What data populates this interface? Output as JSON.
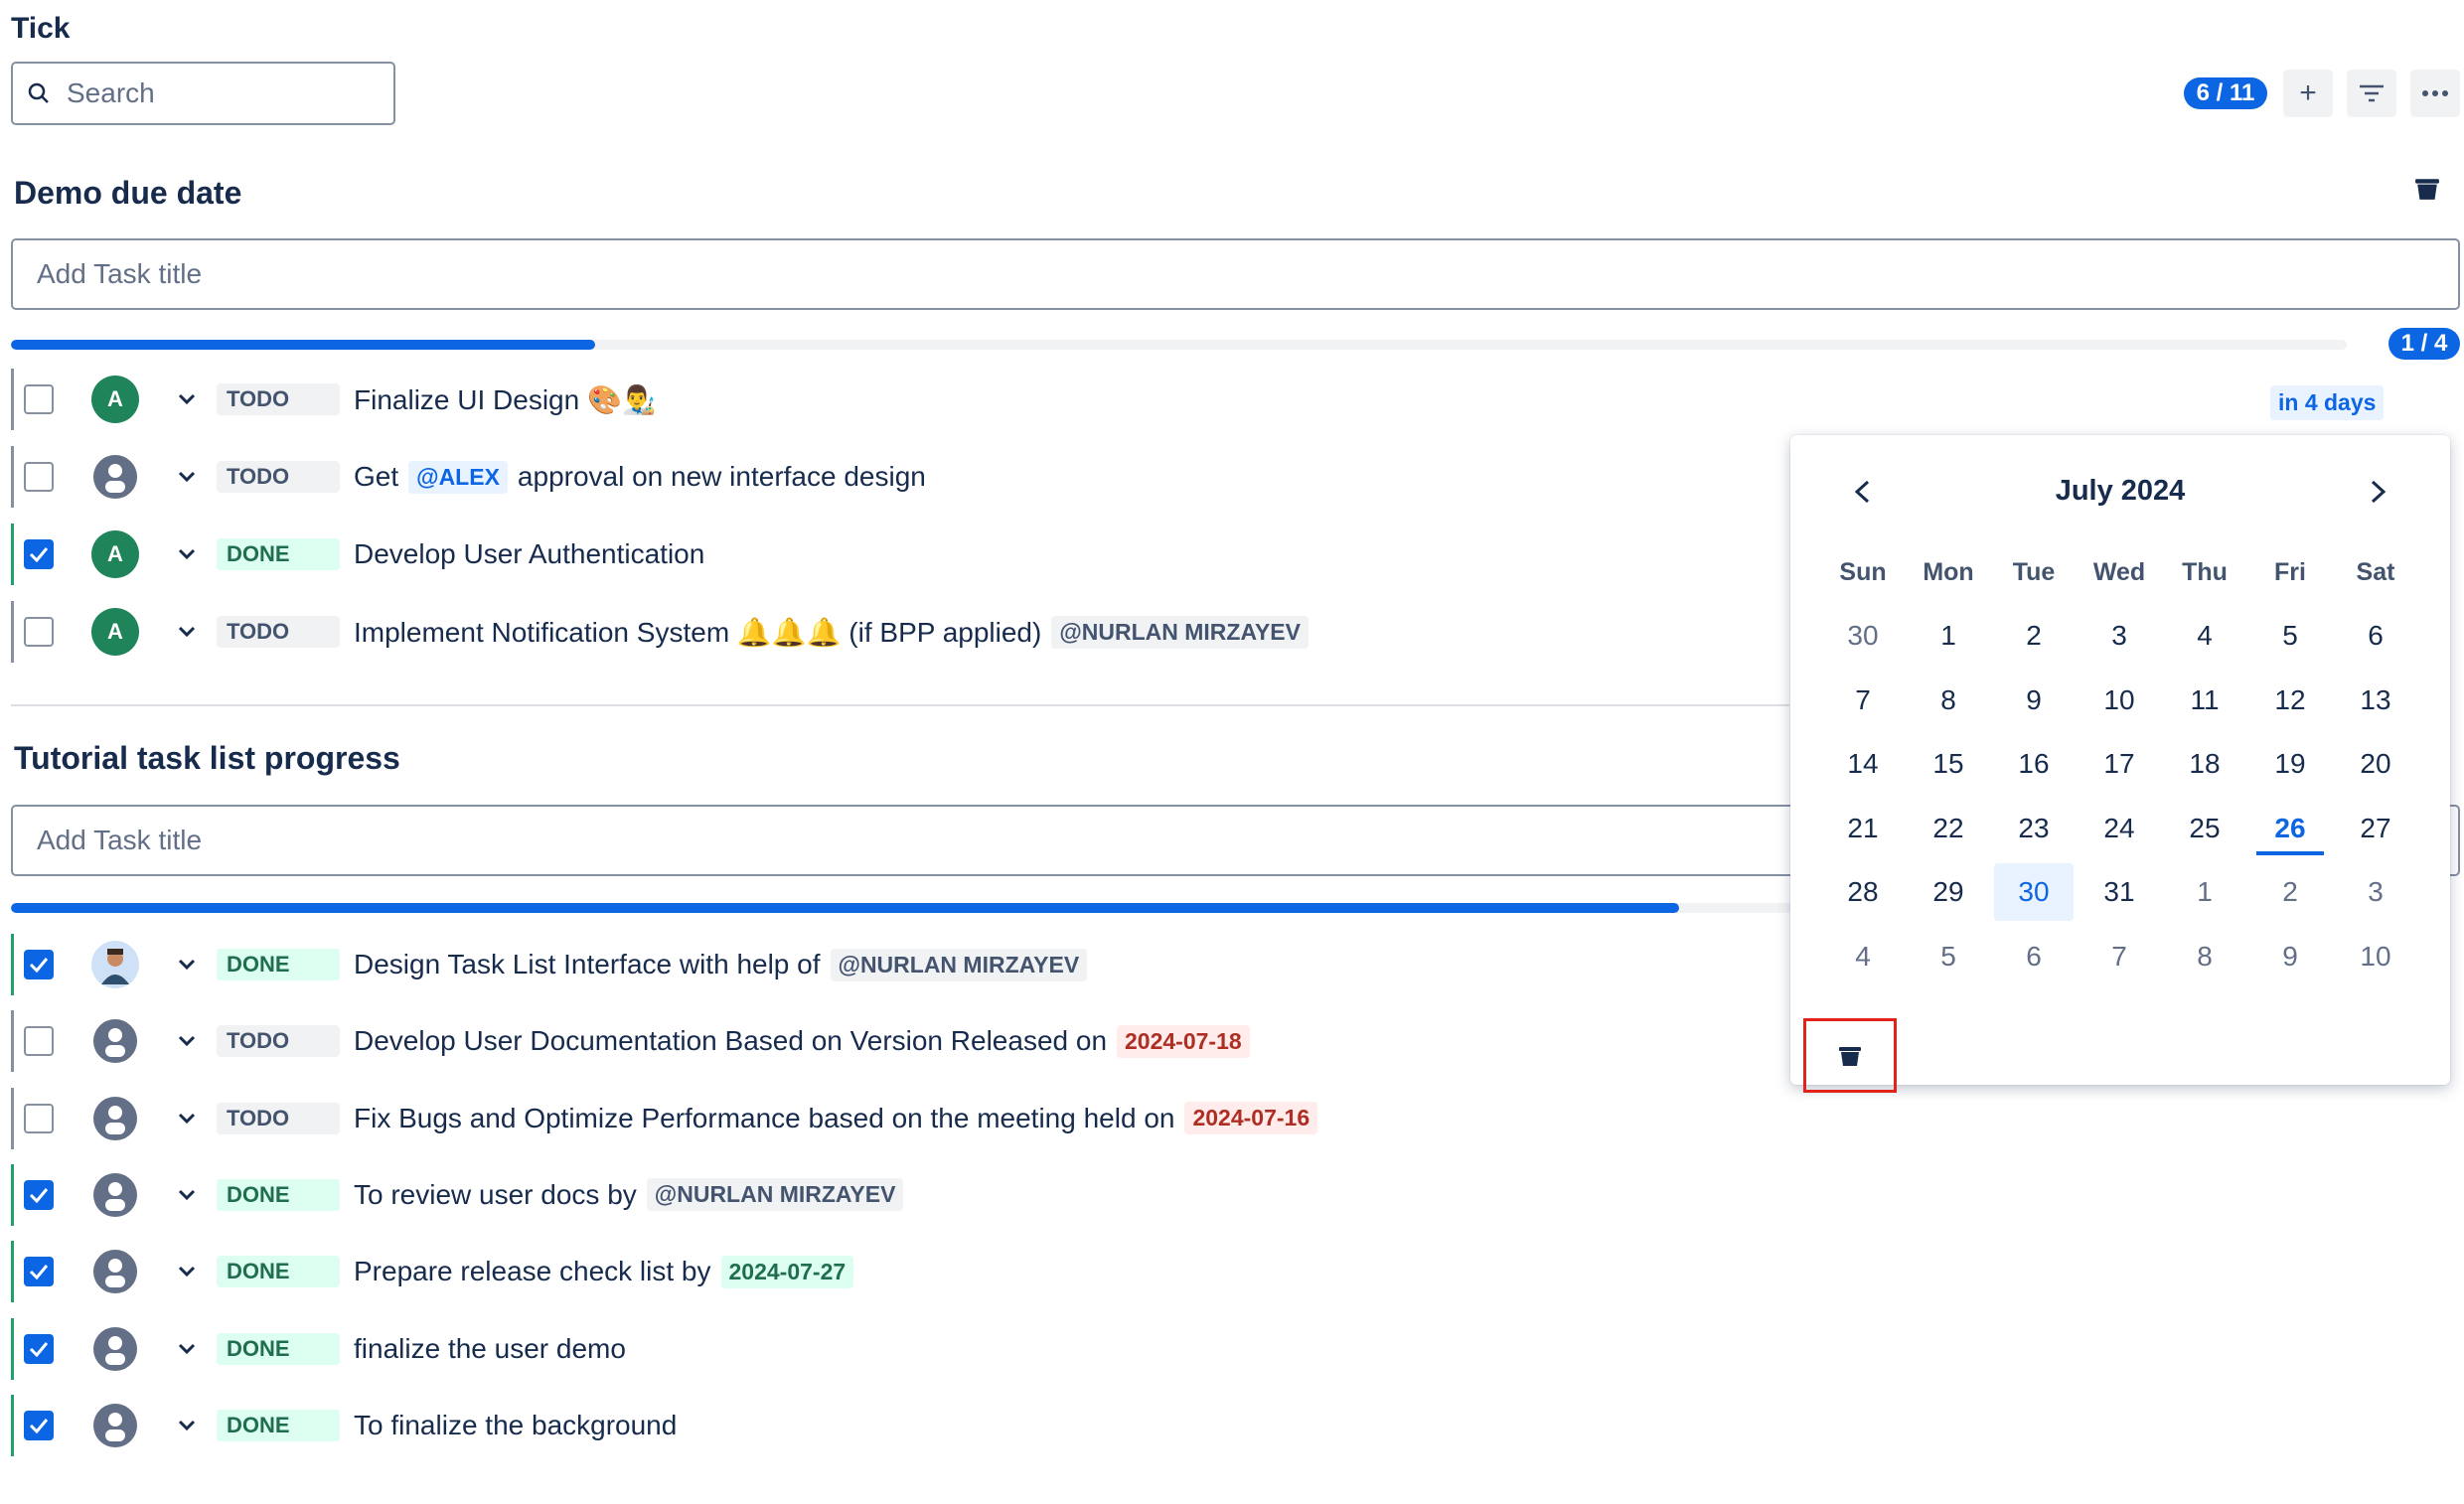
{
  "app": {
    "title": "Tick"
  },
  "search": {
    "placeholder": "Search"
  },
  "toolbar": {
    "count": "6 / 11",
    "add_icon": "plus-icon",
    "filter_icon": "filter-icon",
    "more_icon": "more-icon"
  },
  "colors": {
    "accent": "#0c66e4",
    "done": "#22a06b",
    "todo": "#8590a2"
  },
  "sections": [
    {
      "title": "Demo due date",
      "add_placeholder": "Add Task title",
      "progress": 0.25,
      "count": "1 / 4",
      "due": "in 4 days",
      "tasks": [
        {
          "status": "TODO",
          "checked": false,
          "avatar": "A",
          "parts": [
            {
              "t": "text",
              "v": "Finalize UI Design 🎨👨‍🎨"
            }
          ]
        },
        {
          "status": "TODO",
          "checked": false,
          "avatar": "",
          "parts": [
            {
              "t": "text",
              "v": "Get"
            },
            {
              "t": "mention-blue",
              "v": "@ALEX"
            },
            {
              "t": "text",
              "v": "approval on new interface design"
            }
          ]
        },
        {
          "status": "DONE",
          "checked": true,
          "avatar": "A",
          "parts": [
            {
              "t": "text",
              "v": "Develop User Authentication"
            }
          ]
        },
        {
          "status": "TODO",
          "checked": false,
          "avatar": "A",
          "parts": [
            {
              "t": "text",
              "v": "Implement Notification System 🔔🔔🔔 (if BPP applied)"
            },
            {
              "t": "mention",
              "v": "@NURLAN MIRZAYEV"
            }
          ]
        }
      ]
    },
    {
      "title": "Tutorial task list progress",
      "add_placeholder": "Add Task title",
      "progress": 0.714,
      "tasks": [
        {
          "status": "DONE",
          "checked": true,
          "avatar": "photo",
          "parts": [
            {
              "t": "text",
              "v": "Design Task List Interface with help of"
            },
            {
              "t": "mention",
              "v": "@NURLAN MIRZAYEV"
            }
          ]
        },
        {
          "status": "TODO",
          "checked": false,
          "avatar": "",
          "parts": [
            {
              "t": "text",
              "v": "Develop User Documentation Based on Version Released on"
            },
            {
              "t": "date-red",
              "v": "2024-07-18"
            }
          ]
        },
        {
          "status": "TODO",
          "checked": false,
          "avatar": "",
          "parts": [
            {
              "t": "text",
              "v": "Fix Bugs and Optimize Performance based on the meeting held on"
            },
            {
              "t": "date-red",
              "v": "2024-07-16"
            }
          ]
        },
        {
          "status": "DONE",
          "checked": true,
          "avatar": "",
          "parts": [
            {
              "t": "text",
              "v": "To review user docs by"
            },
            {
              "t": "mention",
              "v": "@NURLAN MIRZAYEV"
            }
          ]
        },
        {
          "status": "DONE",
          "checked": true,
          "avatar": "",
          "parts": [
            {
              "t": "text",
              "v": "Prepare release check list by"
            },
            {
              "t": "date-green",
              "v": "2024-07-27"
            }
          ]
        },
        {
          "status": "DONE",
          "checked": true,
          "avatar": "",
          "parts": [
            {
              "t": "text",
              "v": "finalize the user demo"
            }
          ]
        },
        {
          "status": "DONE",
          "checked": true,
          "avatar": "",
          "parts": [
            {
              "t": "text",
              "v": "To finalize the background"
            }
          ]
        }
      ]
    }
  ],
  "calendar": {
    "month": "July 2024",
    "weekdays": [
      "Sun",
      "Mon",
      "Tue",
      "Wed",
      "Thu",
      "Fri",
      "Sat"
    ],
    "weeks": [
      [
        {
          "d": "30",
          "m": 1
        },
        {
          "d": "1"
        },
        {
          "d": "2"
        },
        {
          "d": "3"
        },
        {
          "d": "4"
        },
        {
          "d": "5"
        },
        {
          "d": "6"
        }
      ],
      [
        {
          "d": "7"
        },
        {
          "d": "8"
        },
        {
          "d": "9"
        },
        {
          "d": "10"
        },
        {
          "d": "11"
        },
        {
          "d": "12"
        },
        {
          "d": "13"
        }
      ],
      [
        {
          "d": "14"
        },
        {
          "d": "15"
        },
        {
          "d": "16"
        },
        {
          "d": "17"
        },
        {
          "d": "18"
        },
        {
          "d": "19"
        },
        {
          "d": "20"
        }
      ],
      [
        {
          "d": "21"
        },
        {
          "d": "22"
        },
        {
          "d": "23"
        },
        {
          "d": "24"
        },
        {
          "d": "25"
        },
        {
          "d": "26",
          "today": 1
        },
        {
          "d": "27"
        }
      ],
      [
        {
          "d": "28"
        },
        {
          "d": "29"
        },
        {
          "d": "30",
          "sel": 1
        },
        {
          "d": "31"
        },
        {
          "d": "1",
          "m": 1
        },
        {
          "d": "2",
          "m": 1
        },
        {
          "d": "3",
          "m": 1
        }
      ],
      [
        {
          "d": "4",
          "m": 1
        },
        {
          "d": "5",
          "m": 1
        },
        {
          "d": "6",
          "m": 1
        },
        {
          "d": "7",
          "m": 1
        },
        {
          "d": "8",
          "m": 1
        },
        {
          "d": "9",
          "m": 1
        },
        {
          "d": "10",
          "m": 1
        }
      ]
    ]
  }
}
